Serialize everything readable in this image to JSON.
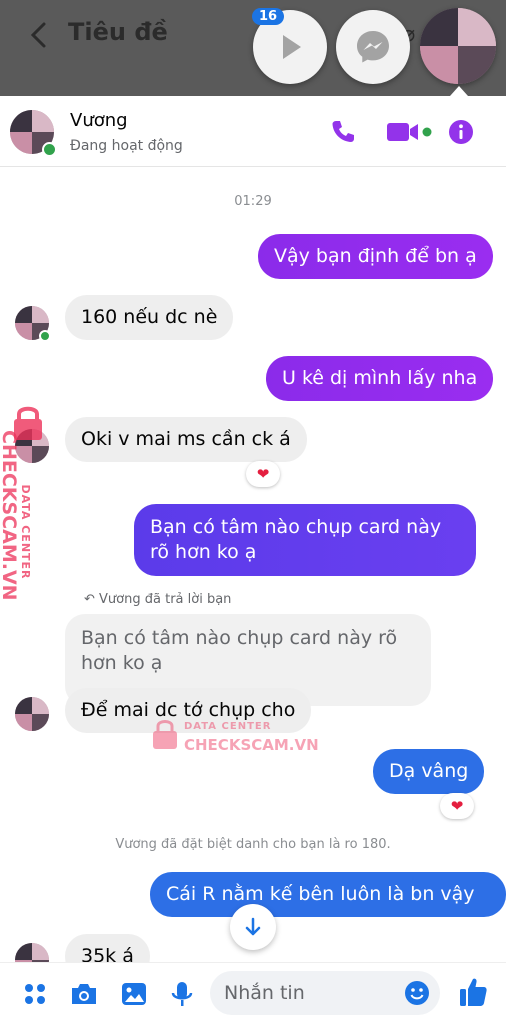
{
  "background_app": {
    "title": "Tiêu đề"
  },
  "chat_heads": {
    "badge_count": "16"
  },
  "header": {
    "name": "Vương",
    "status": "Đang hoạt động"
  },
  "timestamp": "01:29",
  "messages": [
    {
      "text": "Vậy bạn định để bn ạ"
    },
    {
      "text": "160 nếu dc nè"
    },
    {
      "text": "U kê dị mình lấy nha"
    },
    {
      "text": "Oki v mai ms cần ck á"
    },
    {
      "text": "Bạn có tâm nào chụp card này rõ hơn ko ạ"
    },
    {
      "text": "Để mai dc tớ chụp cho"
    },
    {
      "text": "Dạ vâng"
    },
    {
      "text": "Cái R nằm kế bên luôn là bn vậy ạ"
    },
    {
      "text": "35k á"
    }
  ],
  "reply": {
    "label": "Vương đã trả lời bạn",
    "quoted_text": "Bạn có tâm nào chụp card này rõ hơn ko ạ"
  },
  "system_note": "Vương đã đặt biệt danh cho bạn là ro 180.",
  "watermark": {
    "line1": "DATA CENTER",
    "line2": "CHECKSCAM.VN"
  },
  "composer": {
    "placeholder": "Nhắn tin"
  },
  "colors": {
    "accent": "#9333ea",
    "online": "#31a24c",
    "outgoing_blue": "#2d6fe6",
    "heart": "#e41e3f"
  }
}
